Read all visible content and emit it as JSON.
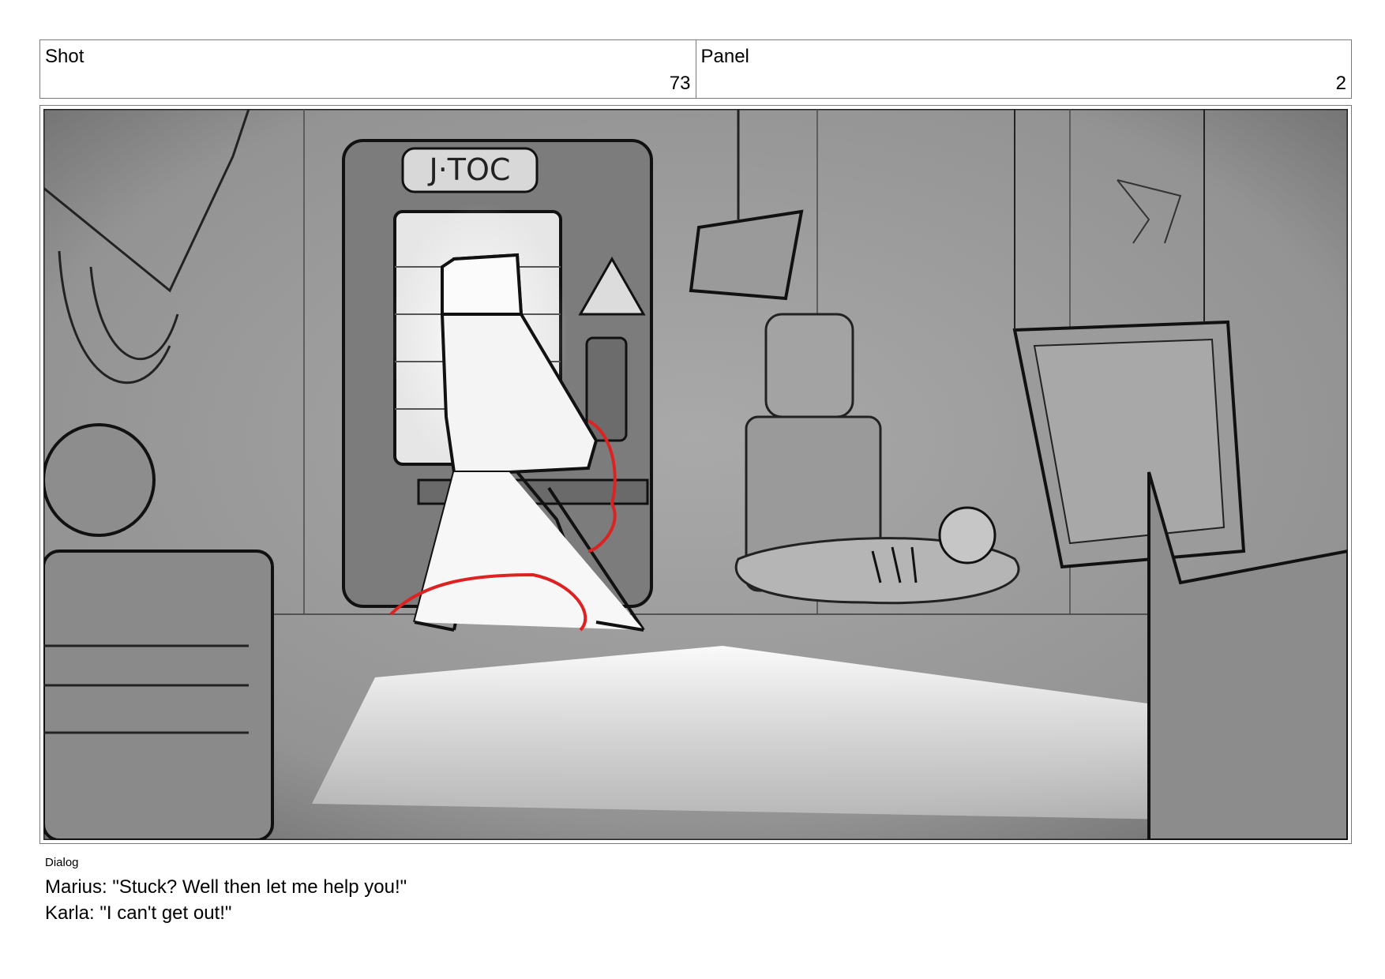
{
  "header": {
    "shot_label": "Shot",
    "shot_number": "73",
    "panel_label": "Panel",
    "panel_number": "2"
  },
  "dialog": {
    "label": "Dialog",
    "lines": [
      "Marius: \"Stuck? Well then let me help you!\"",
      "Karla: \"I can't get out!\""
    ]
  }
}
